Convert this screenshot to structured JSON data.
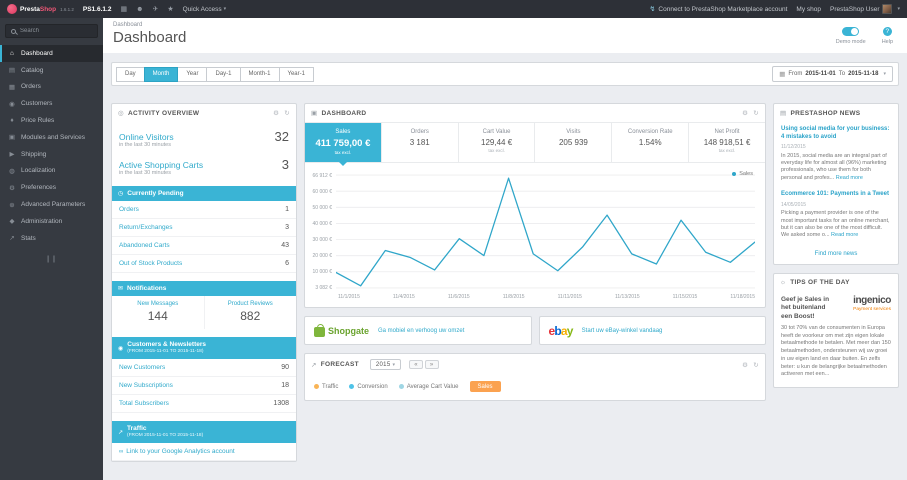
{
  "topbar": {
    "brand_presta": "Presta",
    "brand_shop": "Shop",
    "version": "1.6.1.2",
    "shop_name": "PS1.6.1.2",
    "quick_access": "Quick Access",
    "marketplace_link": "Connect to PrestaShop Marketplace account",
    "my_shop": "My shop",
    "user_menu": "PrestaShop User"
  },
  "sidebar": {
    "search_placeholder": "Search",
    "items": [
      {
        "label": "Dashboard"
      },
      {
        "label": "Catalog"
      },
      {
        "label": "Orders"
      },
      {
        "label": "Customers"
      },
      {
        "label": "Price Rules"
      },
      {
        "label": "Modules and Services"
      },
      {
        "label": "Shipping"
      },
      {
        "label": "Localization"
      },
      {
        "label": "Preferences"
      },
      {
        "label": "Advanced Parameters"
      },
      {
        "label": "Administration"
      },
      {
        "label": "Stats"
      }
    ]
  },
  "header": {
    "breadcrumb": "Dashboard",
    "title": "Dashboard",
    "demo_mode_label": "Demo mode",
    "help_label": "Help"
  },
  "filters": {
    "range_buttons": [
      "Day",
      "Month",
      "Year",
      "Day-1",
      "Month-1",
      "Year-1"
    ],
    "active_button": "Month",
    "date_from_label": "From",
    "date_from": "2015-11-01",
    "date_to_label": "To",
    "date_to": "2015-11-18"
  },
  "activity": {
    "title": "ACTIVITY OVERVIEW",
    "big_metrics": [
      {
        "label": "Online Visitors",
        "value": "32",
        "sub": "in the last 30 minutes"
      },
      {
        "label": "Active Shopping Carts",
        "value": "3",
        "sub": "in the last 30 minutes"
      }
    ],
    "pending": {
      "title": "Currently Pending",
      "rows": [
        {
          "label": "Orders",
          "value": "1"
        },
        {
          "label": "Return/Exchanges",
          "value": "3"
        },
        {
          "label": "Abandoned Carts",
          "value": "43"
        },
        {
          "label": "Out of Stock Products",
          "value": "6"
        }
      ]
    },
    "notifications": {
      "title": "Notifications",
      "cols": [
        {
          "label": "New Messages",
          "value": "144"
        },
        {
          "label": "Product Reviews",
          "value": "882"
        }
      ]
    },
    "customers": {
      "title": "Customers & Newsletters",
      "subtitle": "(FROM 2015-11-01 TO 2015-11-18)",
      "rows": [
        {
          "label": "New Customers",
          "value": "90"
        },
        {
          "label": "New Subscriptions",
          "value": "18"
        },
        {
          "label": "Total Subscribers",
          "value": "1308"
        }
      ]
    },
    "traffic": {
      "title": "Traffic",
      "subtitle": "(FROM 2015-11-01 TO 2015-11-18)",
      "link": "Link to your Google Analytics account"
    }
  },
  "dashboard_panel": {
    "title": "DASHBOARD",
    "kpis": [
      {
        "label": "Sales",
        "value": "411 759,00 €",
        "sub": "tax excl."
      },
      {
        "label": "Orders",
        "value": "3 181",
        "sub": ""
      },
      {
        "label": "Cart Value",
        "value": "129,44 €",
        "sub": "tax excl."
      },
      {
        "label": "Visits",
        "value": "205 939",
        "sub": ""
      },
      {
        "label": "Conversion Rate",
        "value": "1.54%",
        "sub": ""
      },
      {
        "label": "Net Profit",
        "value": "148 918,51 €",
        "sub": "tax excl."
      }
    ],
    "legend": "Sales"
  },
  "chart_data": {
    "type": "line",
    "title": "Sales",
    "series": [
      {
        "name": "Sales",
        "color": "#2fa6c9",
        "values": [
          11000,
          3082,
          24000,
          20000,
          12500,
          31000,
          21000,
          66912,
          22000,
          12000,
          26000,
          45000,
          22000,
          16000,
          42000,
          23000,
          17000,
          29000
        ]
      }
    ],
    "x": [
      "11/1/2015",
      "11/2/2015",
      "11/3/2015",
      "11/4/2015",
      "11/5/2015",
      "11/6/2015",
      "11/7/2015",
      "11/8/2015",
      "11/9/2015",
      "11/10/2015",
      "11/11/2015",
      "11/12/2015",
      "11/13/2015",
      "11/14/2015",
      "11/15/2015",
      "11/16/2015",
      "11/17/2015",
      "11/18/2015"
    ],
    "x_tick_labels": [
      "11/1/2015",
      "11/4/2015",
      "11/6/2015",
      "11/8/2015",
      "11/11/2015",
      "11/13/2015",
      "11/15/2015",
      "11/18/2015"
    ],
    "y_tick_labels": [
      "66 912 €",
      "60 000 €",
      "50 000 €",
      "40 000 €",
      "30 000 €",
      "20 000 €",
      "10 000 €",
      "3 082 €"
    ],
    "ylim": [
      0,
      70000
    ],
    "grid": true,
    "legend_position": "top-right"
  },
  "promos": [
    {
      "name": "Shopgate",
      "link": "Ga mobiel en verhoog uw omzet"
    },
    {
      "name": "ebay",
      "letters": [
        "e",
        "b",
        "a",
        "y"
      ],
      "link": "Start uw eBay-winkel vandaag"
    }
  ],
  "forecast": {
    "title": "FORECAST",
    "year": "2015",
    "legend": [
      {
        "label": "Traffic"
      },
      {
        "label": "Conversion"
      },
      {
        "label": "Average Cart Value"
      }
    ],
    "active_metric": "Sales"
  },
  "news": {
    "title": "PRESTASHOP NEWS",
    "articles": [
      {
        "title": "Using social media for your business: 4 mistakes to avoid",
        "date": "11/12/2015",
        "excerpt": "In 2015, social media are an integral part of everyday life for almost all (96%) marketing professionals, who use them for both personal and profes...",
        "read_more": "Read more"
      },
      {
        "title": "Ecommerce 101: Payments in a Tweet",
        "date": "14/05/2015",
        "excerpt": "Picking a payment provider is one of the most important tasks for an online merchant, but it can also be one of the most difficult. We asked some o...",
        "read_more": "Read more"
      }
    ],
    "find_more": "Find more news"
  },
  "tips": {
    "title": "TIPS OF THE DAY",
    "headline": "Geef je Sales in het buitenland een Boost!",
    "brand": "ingenico",
    "brand_sub": "Payment services",
    "body": "30 tot 70% van de consumenten in Europa heeft de voorkeur om met zijn eigen lokale betaalmethode te betalen. Met meer dan 150 betaalmethoden, ondersteunen wij uw groei in uw eigen land en daar buiten. En zelfs beter: u kun de belangrijke betaalmethoden activeren met een..."
  },
  "colors": {
    "accent": "#3ab4d5",
    "link": "#2aa3c9",
    "orange": "#fba250",
    "shopgate_green": "#7fb63c",
    "ebay_letters": [
      "#e53238",
      "#0064d2",
      "#f5af02",
      "#86b817"
    ]
  }
}
